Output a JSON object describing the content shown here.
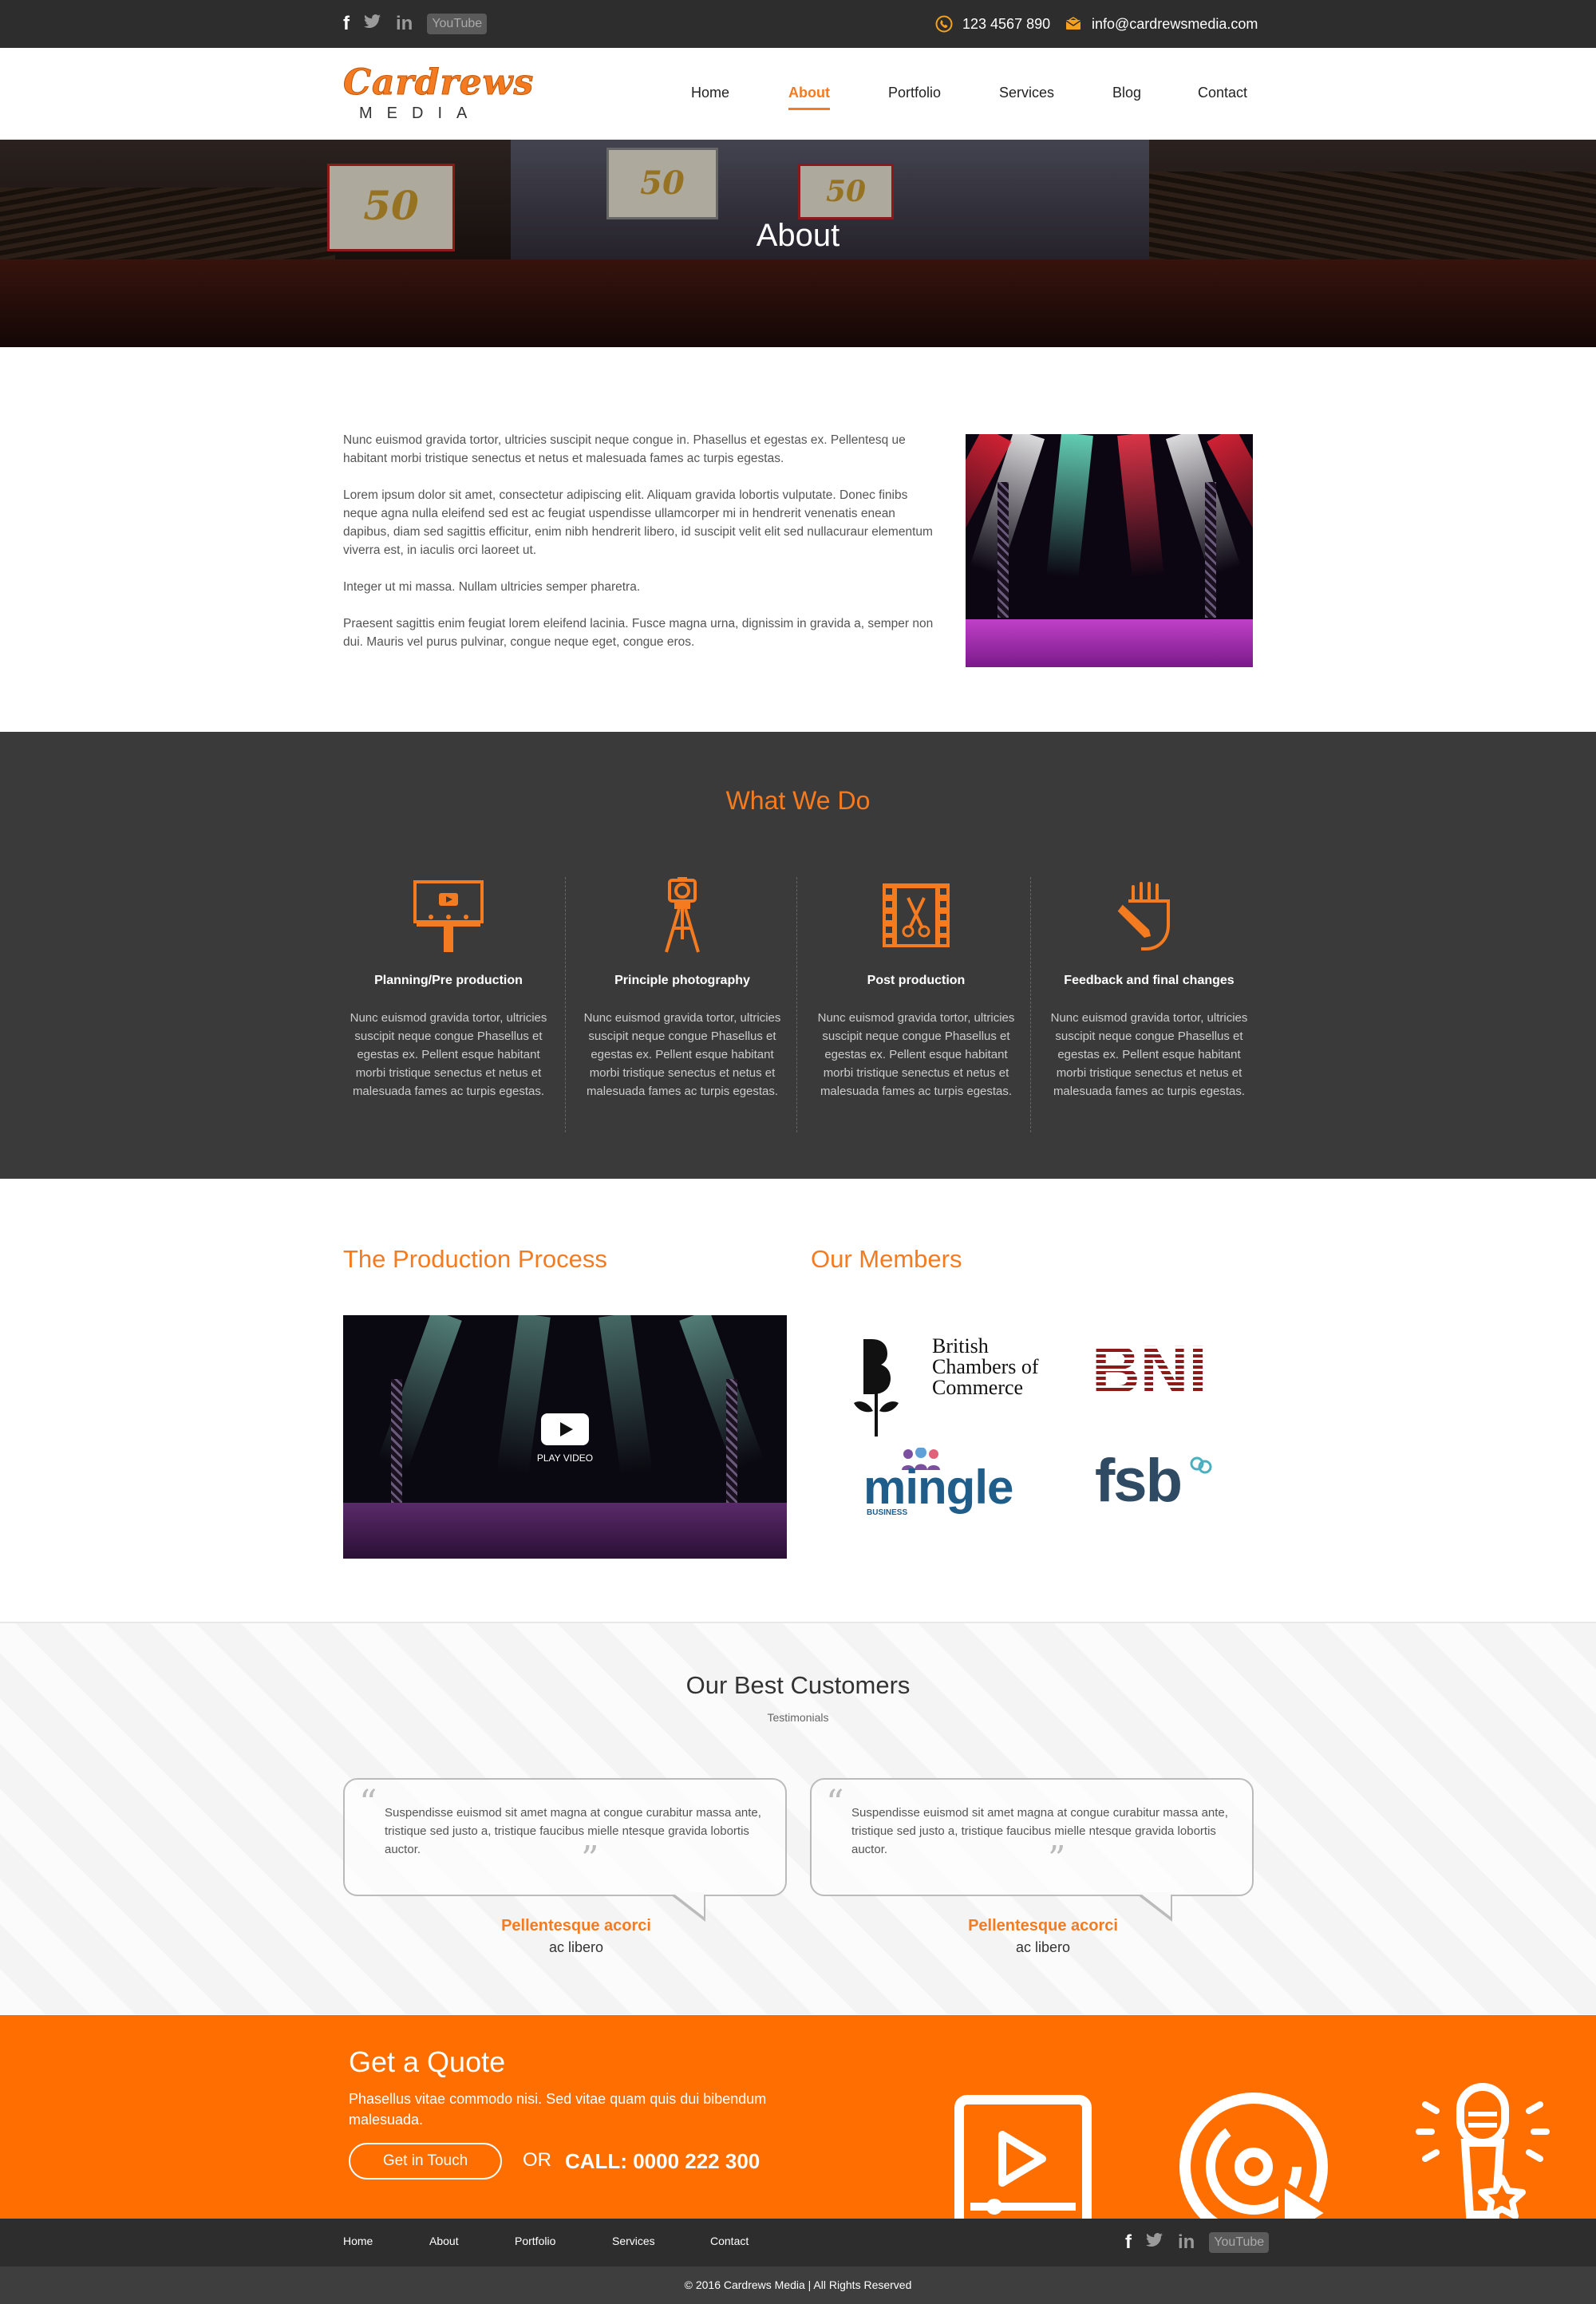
{
  "topbar": {
    "social": [
      {
        "icon": "facebook-icon",
        "glyph": "f"
      },
      {
        "icon": "twitter-icon",
        "glyph": "t"
      },
      {
        "icon": "linkedin-icon",
        "glyph": "in"
      },
      {
        "icon": "youtube-icon",
        "glyph": "YouTube"
      }
    ],
    "phone": "123 4567 890",
    "email": "info@cardrewsmedia.com"
  },
  "header": {
    "logo_script": "Cardrews",
    "logo_sub": "MEDIA",
    "nav": [
      "Home",
      "About",
      "Portfolio",
      "Services",
      "Blog",
      "Contact"
    ],
    "active_nav": "About"
  },
  "hero": {
    "title": "About",
    "screen_text": "50"
  },
  "about": {
    "paragraphs": [
      "Nunc euismod gravida tortor, ultricies suscipit neque congue in. Phasellus et egestas ex. Pellentesq ue habitant morbi tristique senectus et netus et malesuada fames ac turpis egestas.",
      "Lorem ipsum dolor sit amet, consectetur adipiscing elit. Aliquam gravida lobortis vulputate. Donec finibs neque agna nulla eleifend sed est ac feugiat uspendisse ullamcorper mi in hendrerit venenatis enean dapibus, diam sed sagittis efficitur, enim nibh hendrerit libero, id suscipit velit elit sed nullacuraur elementum viverra est, in iaculis orci laoreet ut.",
      "Integer ut mi massa. Nullam ultricies semper pharetra.",
      "Praesent sagittis enim feugiat lorem eleifend lacinia. Fusce magna urna, dignissim in gravida a, semper non dui. Mauris vel purus pulvinar, congue neque eget, congue eros."
    ]
  },
  "what_we_do": {
    "title": "What We Do",
    "services": [
      {
        "icon": "billboard-icon",
        "title": "Planning/Pre production",
        "text": "Nunc euismod gravida tortor, ultricies suscipit neque congue Phasellus et egestas ex. Pellent esque habitant morbi tristique senectus et netus et malesuada fames ac turpis egestas."
      },
      {
        "icon": "camera-tripod-icon",
        "title": "Principle photography",
        "text": "Nunc euismod gravida tortor, ultricies suscipit neque congue Phasellus et egestas ex. Pellent esque habitant morbi tristique senectus et netus et malesuada fames ac turpis egestas."
      },
      {
        "icon": "film-scissors-icon",
        "title": "Post production",
        "text": "Nunc euismod gravida tortor, ultricies suscipit neque congue Phasellus et egestas ex. Pellent esque habitant morbi tristique senectus et netus et malesuada fames ac turpis egestas."
      },
      {
        "icon": "hand-pencil-icon",
        "title": "Feedback and final changes",
        "text": "Nunc euismod gravida tortor, ultricies suscipit neque congue Phasellus et egestas ex. Pellent esque habitant morbi tristique senectus et netus et malesuada fames ac turpis egestas."
      }
    ]
  },
  "production": {
    "title": "The Production Process",
    "play_label": "PLAY VIDEO"
  },
  "members": {
    "title": "Our Members",
    "bcc_lines": [
      "British",
      "Chambers of",
      "Commerce"
    ],
    "bni": "BNI",
    "mingle": "mingle",
    "mingle_sub": "BUSINESS",
    "fsb": "fsb"
  },
  "testimonials": {
    "title": "Our Best Customers",
    "subtitle": "Testimonials",
    "items": [
      {
        "quote": "Suspendisse euismod sit amet magna at congue curabitur massa ante, tristique sed justo a, tristique faucibus mielle ntesque gravida lobortis auctor.",
        "name": "Pellentesque acorci",
        "role": "ac libero"
      },
      {
        "quote": "Suspendisse euismod sit amet magna at congue curabitur massa ante, tristique sed justo a, tristique faucibus mielle ntesque gravida lobortis auctor.",
        "name": "Pellentesque acorci",
        "role": "ac libero"
      }
    ]
  },
  "quote": {
    "title": "Get a Quote",
    "description": "Phasellus vitae commodo nisi. Sed vitae quam quis dui bibendum malesuada.",
    "button": "Get in Touch",
    "or": "OR",
    "call": "CALL: 0000 222 300"
  },
  "footer": {
    "nav": [
      "Home",
      "About",
      "Portfolio",
      "Services",
      "Contact"
    ],
    "copyright": "© 2016 Cardrews Media   |   All Rights Reserved"
  },
  "colors": {
    "accent": "#f47b20",
    "quote_bg": "#ff6e00",
    "dark": "#2d2d2d",
    "section_dark": "#3a3a3a"
  }
}
